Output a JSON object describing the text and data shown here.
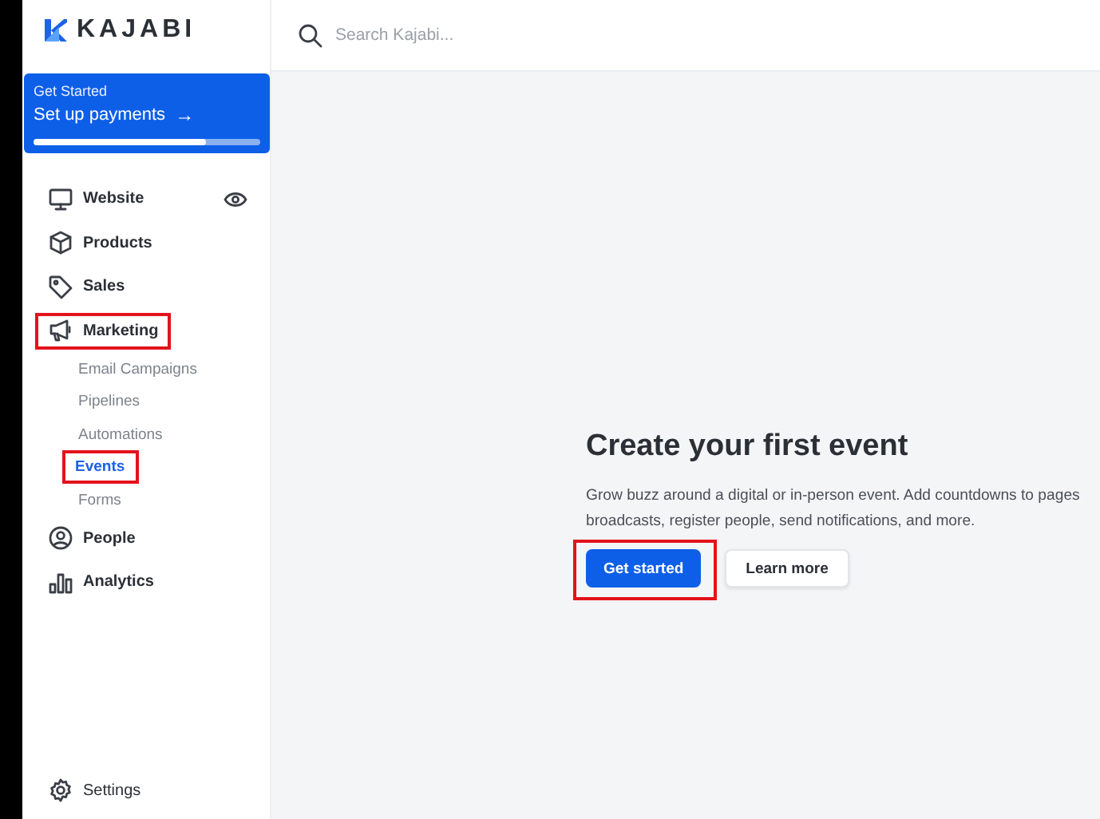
{
  "brand": {
    "name": "KAJABI"
  },
  "search": {
    "placeholder": "Search Kajabi..."
  },
  "setup_card": {
    "label": "Get Started",
    "title": "Set up payments",
    "arrow": "→",
    "level": 0.76
  },
  "nav": [
    {
      "label": "Website",
      "selected": false,
      "highlighted": false,
      "preview": true
    },
    {
      "label": "Products",
      "selected": false,
      "highlighted": false,
      "preview": false
    },
    {
      "label": "Sales",
      "selected": false,
      "highlighted": false,
      "preview": false
    },
    {
      "label": "Marketing",
      "selected": false,
      "highlighted": true,
      "preview": false,
      "children": [
        {
          "label": "Email Campaigns",
          "selected": false,
          "highlighted": false
        },
        {
          "label": "Pipelines",
          "selected": false,
          "highlighted": false
        },
        {
          "label": "Automations",
          "selected": false,
          "highlighted": false
        },
        {
          "label": "Events",
          "selected": true,
          "highlighted": true
        },
        {
          "label": "Forms",
          "selected": false,
          "highlighted": false
        }
      ]
    },
    {
      "label": "People",
      "selected": false,
      "highlighted": false,
      "preview": false
    },
    {
      "label": "Analytics",
      "selected": false,
      "highlighted": false,
      "preview": false
    }
  ],
  "settings": {
    "label": "Settings"
  },
  "empty_state": {
    "title": "Create your first event",
    "description_lines": [
      "Grow buzz around a digital or in-person event. Add countdowns to pages",
      "broadcasts, register people, send notifications, and more."
    ],
    "buttons": [
      {
        "label": "Get started",
        "kind": "primary",
        "highlighted": true
      },
      {
        "label": "Learn more",
        "kind": "secondary",
        "highlighted": false
      }
    ]
  }
}
